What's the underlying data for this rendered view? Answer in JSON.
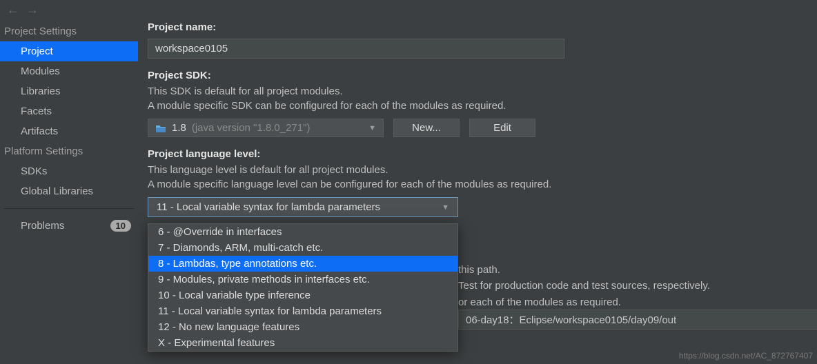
{
  "nav": {
    "back": "←",
    "forward": "→"
  },
  "sidebar": {
    "heading1": "Project Settings",
    "items1": [
      "Project",
      "Modules",
      "Libraries",
      "Facets",
      "Artifacts"
    ],
    "heading2": "Platform Settings",
    "items2": [
      "SDKs",
      "Global Libraries"
    ],
    "problems_label": "Problems",
    "problems_count": "10"
  },
  "main": {
    "project_name_label": "Project name:",
    "project_name_value": "workspace0105",
    "sdk_label": "Project SDK:",
    "sdk_desc1": "This SDK is default for all project modules.",
    "sdk_desc2": "A module specific SDK can be configured for each of the modules as required.",
    "sdk_combo_main": "1.8",
    "sdk_combo_dim": "(java version \"1.8.0_271\")",
    "btn_new": "New...",
    "btn_edit": "Edit",
    "lang_label": "Project language level:",
    "lang_desc1": "This language level is default for all project modules.",
    "lang_desc2": "A module specific language level can be configured for each of the modules as required.",
    "lang_combo_value": "11 - Local variable syntax for lambda parameters",
    "dropdown": [
      "6 - @Override in interfaces",
      "7 - Diamonds, ARM, multi-catch etc.",
      "8 - Lambdas, type annotations etc.",
      "9 - Modules, private methods in interfaces etc.",
      "10 - Local variable type inference",
      "11 - Local variable syntax for lambda parameters",
      "12 - No new language features",
      "X - Experimental features"
    ],
    "behind_line1": "this path.",
    "behind_line2": "Test for production code and test sources, respectively.",
    "behind_line3": "or each of the modules as required.",
    "out_path": "06-day18：Eclipse/workspace0105/day09/out"
  },
  "colors": {
    "accent": "#0d6ef5"
  },
  "watermark": "https://blog.csdn.net/AC_872767407"
}
